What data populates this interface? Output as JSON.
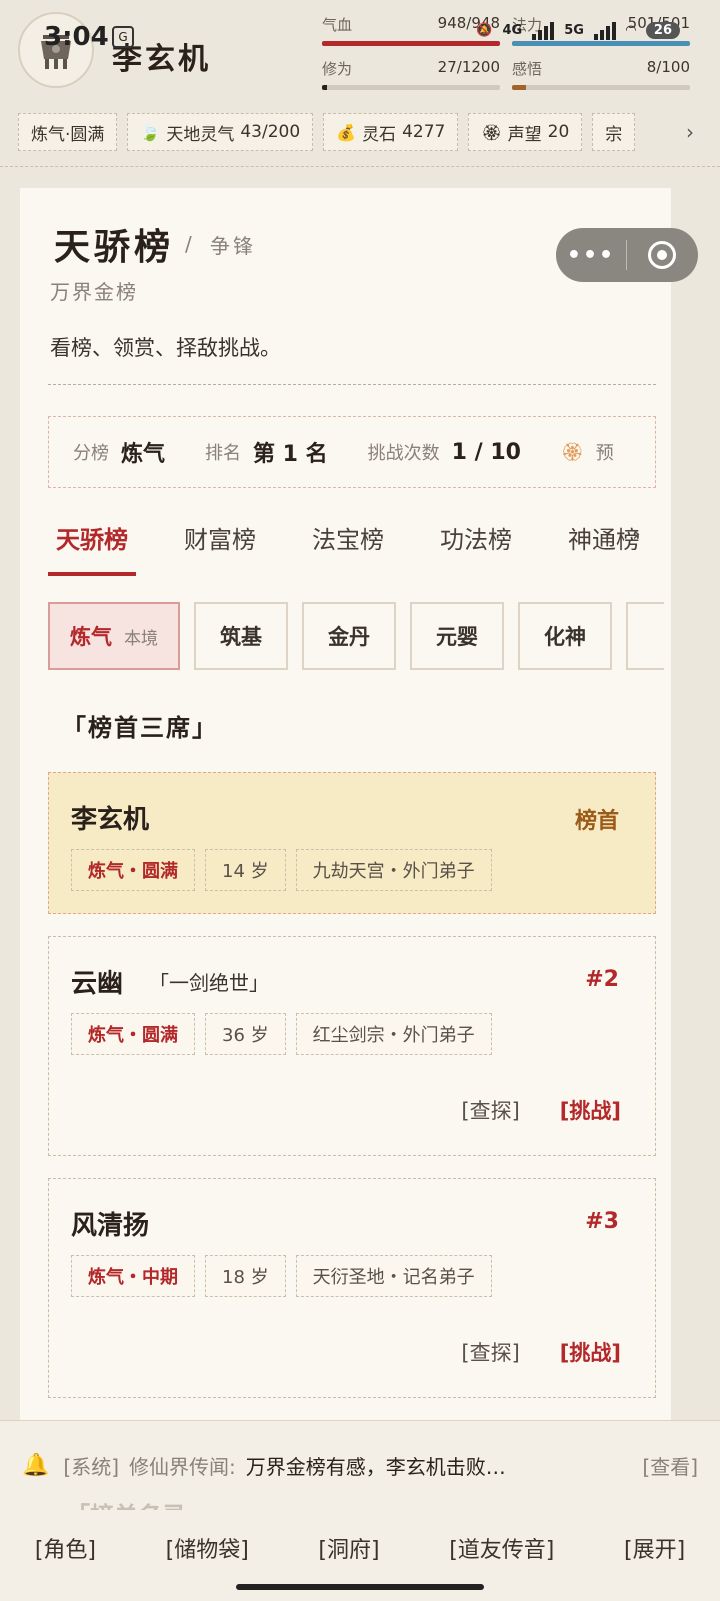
{
  "status_bar": {
    "time": "3:04",
    "network_1": "4G",
    "network_2": "5G",
    "battery": "26"
  },
  "player": {
    "name": "李玄机",
    "stats": [
      {
        "label": "气血",
        "value": "948/948",
        "fraction": 1.0,
        "color": "#b3292b"
      },
      {
        "label": "法力",
        "value": "501/501",
        "fraction": 1.0,
        "color": "#4a8fb5"
      },
      {
        "label": "修为",
        "value": "27/1200",
        "fraction": 0.0225,
        "color": "#2a211a"
      },
      {
        "label": "感悟",
        "value": "8/100",
        "fraction": 0.08,
        "color": "#a3642a"
      }
    ]
  },
  "resources": [
    {
      "icon": "",
      "label": "炼气·圆满",
      "value": ""
    },
    {
      "icon": "🍃",
      "label": "天地灵气",
      "value": "43/200"
    },
    {
      "icon": "💰",
      "label": "灵石",
      "value": "4277"
    },
    {
      "icon": "🏵",
      "label": "声望",
      "value": "20"
    },
    {
      "icon": "",
      "label": "宗",
      "value": ""
    }
  ],
  "page": {
    "title": "天骄榜",
    "title_sep": "/",
    "title_sub": "争锋",
    "board_name": "万界金榜",
    "description": "看榜、领赏、择敌挑战。"
  },
  "rank_info": {
    "division_label": "分榜",
    "division_value": "炼气",
    "rank_label": "排名",
    "rank_value": "第 1 名",
    "challenges_label": "挑战次数",
    "challenges_value": "1 / 10",
    "extra_label": "预"
  },
  "tabs": [
    "天骄榜",
    "财富榜",
    "法宝榜",
    "功法榜",
    "神通榜"
  ],
  "realms": [
    {
      "label": "炼气",
      "badge": "本境"
    },
    {
      "label": "筑基",
      "badge": ""
    },
    {
      "label": "金丹",
      "badge": ""
    },
    {
      "label": "元婴",
      "badge": ""
    },
    {
      "label": "化神",
      "badge": ""
    },
    {
      "label": "",
      "badge": ""
    }
  ],
  "section_top3": "「榜首三席」",
  "entries": [
    {
      "name": "李玄机",
      "title": "",
      "rank": "榜首",
      "realm": "炼气・圆满",
      "age": "14 岁",
      "sect": "九劫天宫・外门弟子",
      "probe": "",
      "challenge": ""
    },
    {
      "name": "云幽",
      "title": "「一剑绝世」",
      "rank": "#2",
      "realm": "炼气・圆满",
      "age": "36 岁",
      "sect": "红尘剑宗・外门弟子",
      "probe": "[查探]",
      "challenge": "[挑战]"
    },
    {
      "name": "风清扬",
      "title": "",
      "rank": "#3",
      "realm": "炼气・中期",
      "age": "18 岁",
      "sect": "天衍圣地・记名弟子",
      "probe": "[查探]",
      "challenge": "[挑战]"
    }
  ],
  "notice": {
    "source": "[系统]",
    "prefix": "修仙界传闻:",
    "message": "万界金榜有感，李玄机击败…",
    "action": "[查看]"
  },
  "section_list": "「榜单名录」",
  "bottom_nav": [
    "[角色]",
    "[储物袋]",
    "[洞府]",
    "[道友传音]",
    "[展开]"
  ]
}
